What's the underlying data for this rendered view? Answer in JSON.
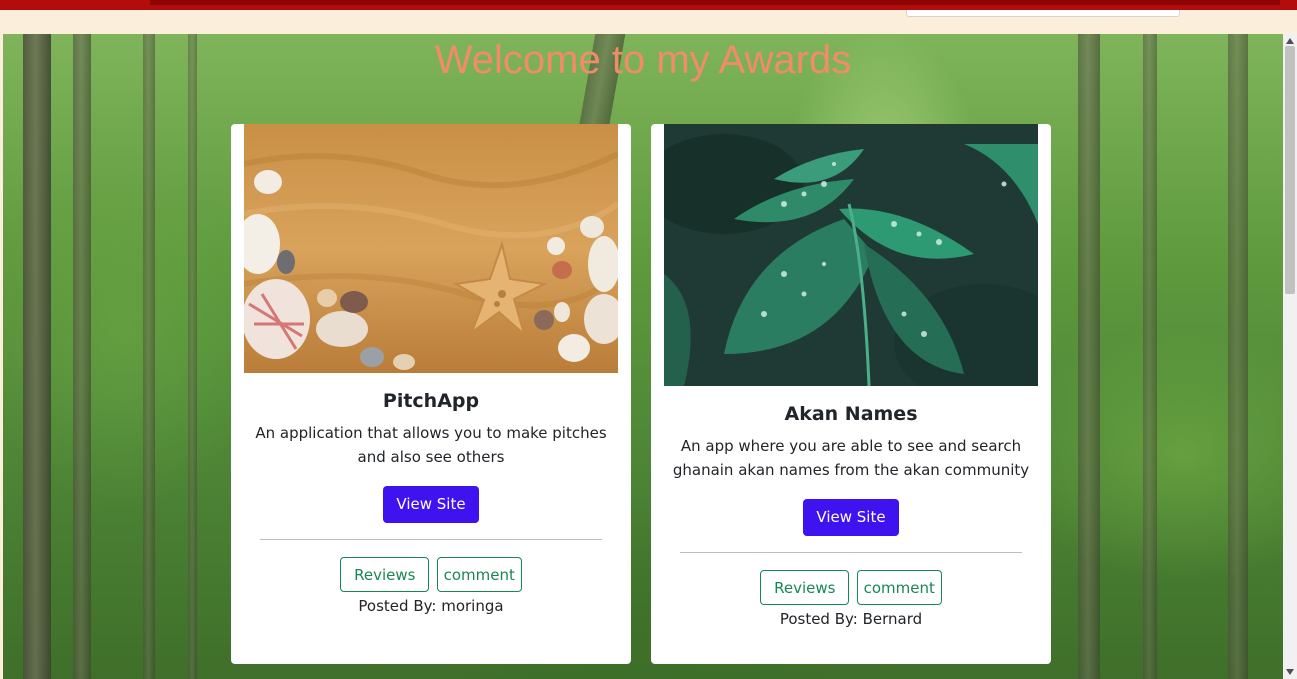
{
  "page": {
    "title": "Welcome to my Awards"
  },
  "projects": [
    {
      "title": "PitchApp",
      "description": "An application that allows you to make pitches and also see others",
      "view_label": "View Site",
      "reviews_label": "Reviews",
      "comment_label": "comment",
      "posted_by": "Posted By: moringa",
      "image": "seashells-on-sand"
    },
    {
      "title": "Akan Names",
      "description": "An app where you are able to see and search ghanain akan names from the akan community",
      "view_label": "View Site",
      "reviews_label": "Reviews",
      "comment_label": "comment",
      "posted_by": "Posted By: Bernard",
      "image": "green-leaves-with-water-drops"
    }
  ],
  "colors": {
    "title": "#f08c6a",
    "primary_button": "#3f12f0",
    "outline_button": "#198754",
    "topbar": "#b20c0c",
    "nav_background": "#fbeedb"
  },
  "icons": {
    "scroll_up": "triangle-up-icon",
    "scroll_down": "triangle-down-icon"
  }
}
